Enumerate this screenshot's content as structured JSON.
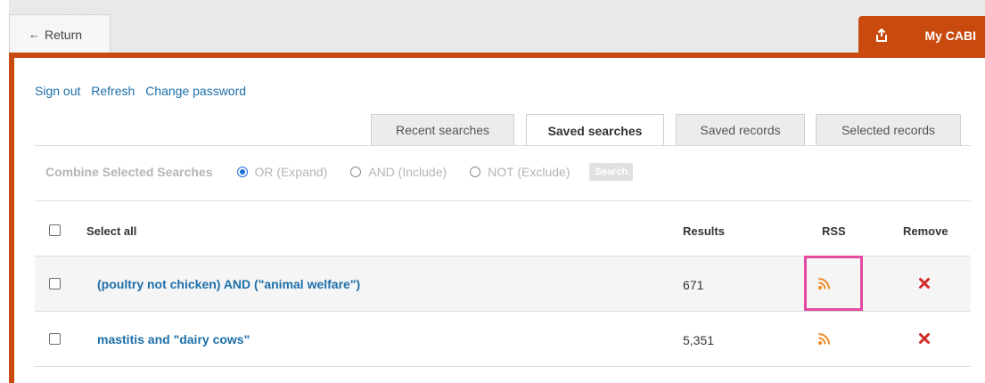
{
  "header": {
    "return_label": "Return",
    "mycabi_label": "My CABI"
  },
  "links": [
    "Sign out",
    "Refresh",
    "Change password"
  ],
  "tabs": [
    {
      "label": "Recent searches",
      "active": false
    },
    {
      "label": "Saved searches",
      "active": true
    },
    {
      "label": "Saved records",
      "active": false
    },
    {
      "label": "Selected records",
      "active": false
    }
  ],
  "combine": {
    "title": "Combine Selected Searches",
    "options": [
      {
        "label": "OR (Expand)",
        "selected": true
      },
      {
        "label": "AND (Include)",
        "selected": false
      },
      {
        "label": "NOT (Exclude)",
        "selected": false
      }
    ],
    "button_label": "Search"
  },
  "table": {
    "select_all": "Select all",
    "columns": {
      "results": "Results",
      "rss": "RSS",
      "remove": "Remove"
    },
    "rows": [
      {
        "query": "(poultry not chicken) AND (\"animal welfare\")",
        "results": "671"
      },
      {
        "query": "mastitis and \"dairy cows\"",
        "results": "5,351"
      }
    ]
  },
  "colors": {
    "accent": "#c94a0e",
    "link": "#1d6fa8",
    "rss": "#f08a24",
    "remove": "#d42b2b",
    "highlight": "#e44aa0"
  },
  "icons": {
    "return": "left-arrow-icon",
    "mycabi": "export-icon",
    "rss": "rss-icon",
    "remove": "close-icon"
  }
}
